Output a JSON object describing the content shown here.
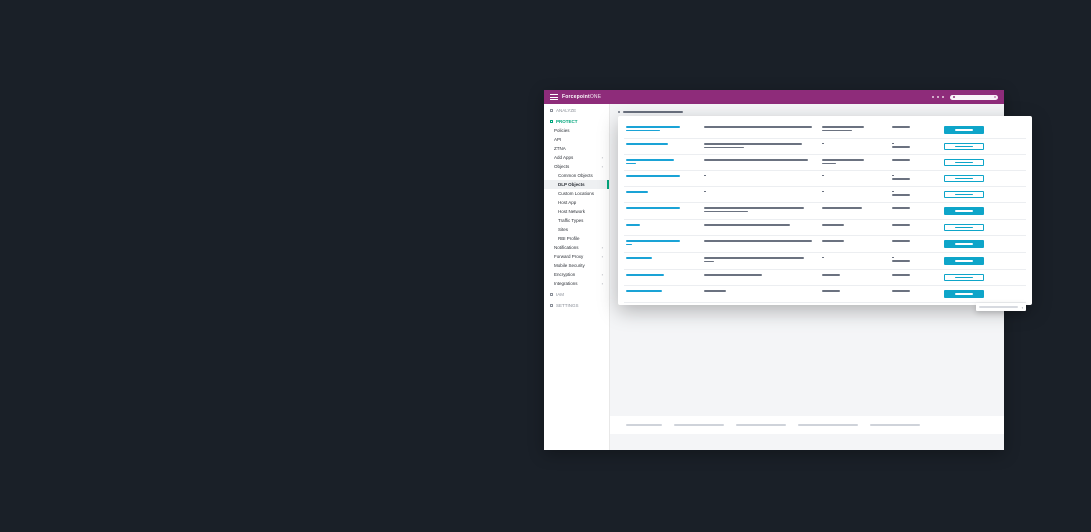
{
  "brand": {
    "strong": "Forcepoint",
    "light": "ONE"
  },
  "nav": {
    "analyze": "ANALYZE",
    "protect": "PROTECT",
    "iam": "IAM",
    "settings": "SETTINGS",
    "items": {
      "policies": "Policies",
      "api": "API",
      "ztna": "ZTNA",
      "addapps": "Add Apps",
      "objects": "Objects",
      "common": "Common Objects",
      "dlp": "DLP Objects",
      "customloc": "Custom Locations",
      "hostapp": "Host App",
      "hostnet": "Host Network",
      "traffic": "Traffic Types",
      "sites": "Sites",
      "rbi": "RBI Profile",
      "notifications": "Notifications",
      "fwdproxy": "Forward Proxy",
      "mobilesec": "Mobile Security",
      "encryption": "Encryption",
      "integrations": "Integrations"
    }
  },
  "table": {
    "rows": [
      {
        "nameW": 54,
        "nameW2": 34,
        "descW": 108,
        "c3W": 42,
        "c3W2": 30,
        "c4W": 18,
        "action": "solid"
      },
      {
        "nameW": 42,
        "descW": 98,
        "descW2": 40,
        "c3": "-",
        "c4": "-",
        "c4b": 18,
        "action": "outline"
      },
      {
        "nameW": 48,
        "nameW2": 10,
        "descW": 104,
        "c3W": 42,
        "c3W2": 14,
        "c4W": 18,
        "action": "outline"
      },
      {
        "nameW": 54,
        "nameW2": 0,
        "desc": "-",
        "c3": "-",
        "c4": "-",
        "c4b": 18,
        "action": "outline"
      },
      {
        "nameW": 22,
        "desc": "-",
        "c3": "-",
        "c4": "-",
        "c4b": 18,
        "action": "outline"
      },
      {
        "nameW": 54,
        "nameW2": 0,
        "descW": 100,
        "descW2": 44,
        "c3W": 40,
        "c4W": 18,
        "action": "solid"
      },
      {
        "nameW": 14,
        "descW": 86,
        "c3W": 22,
        "c4W": 18,
        "action": "outline"
      },
      {
        "nameW": 54,
        "nameW2": 6,
        "descW": 108,
        "c3W": 22,
        "c4W": 18,
        "action": "solid"
      },
      {
        "nameW": 26,
        "descW": 100,
        "descW2": 10,
        "c3": "-",
        "c4": "-",
        "c4b": 18,
        "action": "solid"
      },
      {
        "nameW": 38,
        "descW": 58,
        "c3W": 18,
        "c4W": 18,
        "action": "outline"
      },
      {
        "nameW": 36,
        "descW": 22,
        "c3W": 18,
        "c4W": 18,
        "action": "solid"
      }
    ]
  }
}
